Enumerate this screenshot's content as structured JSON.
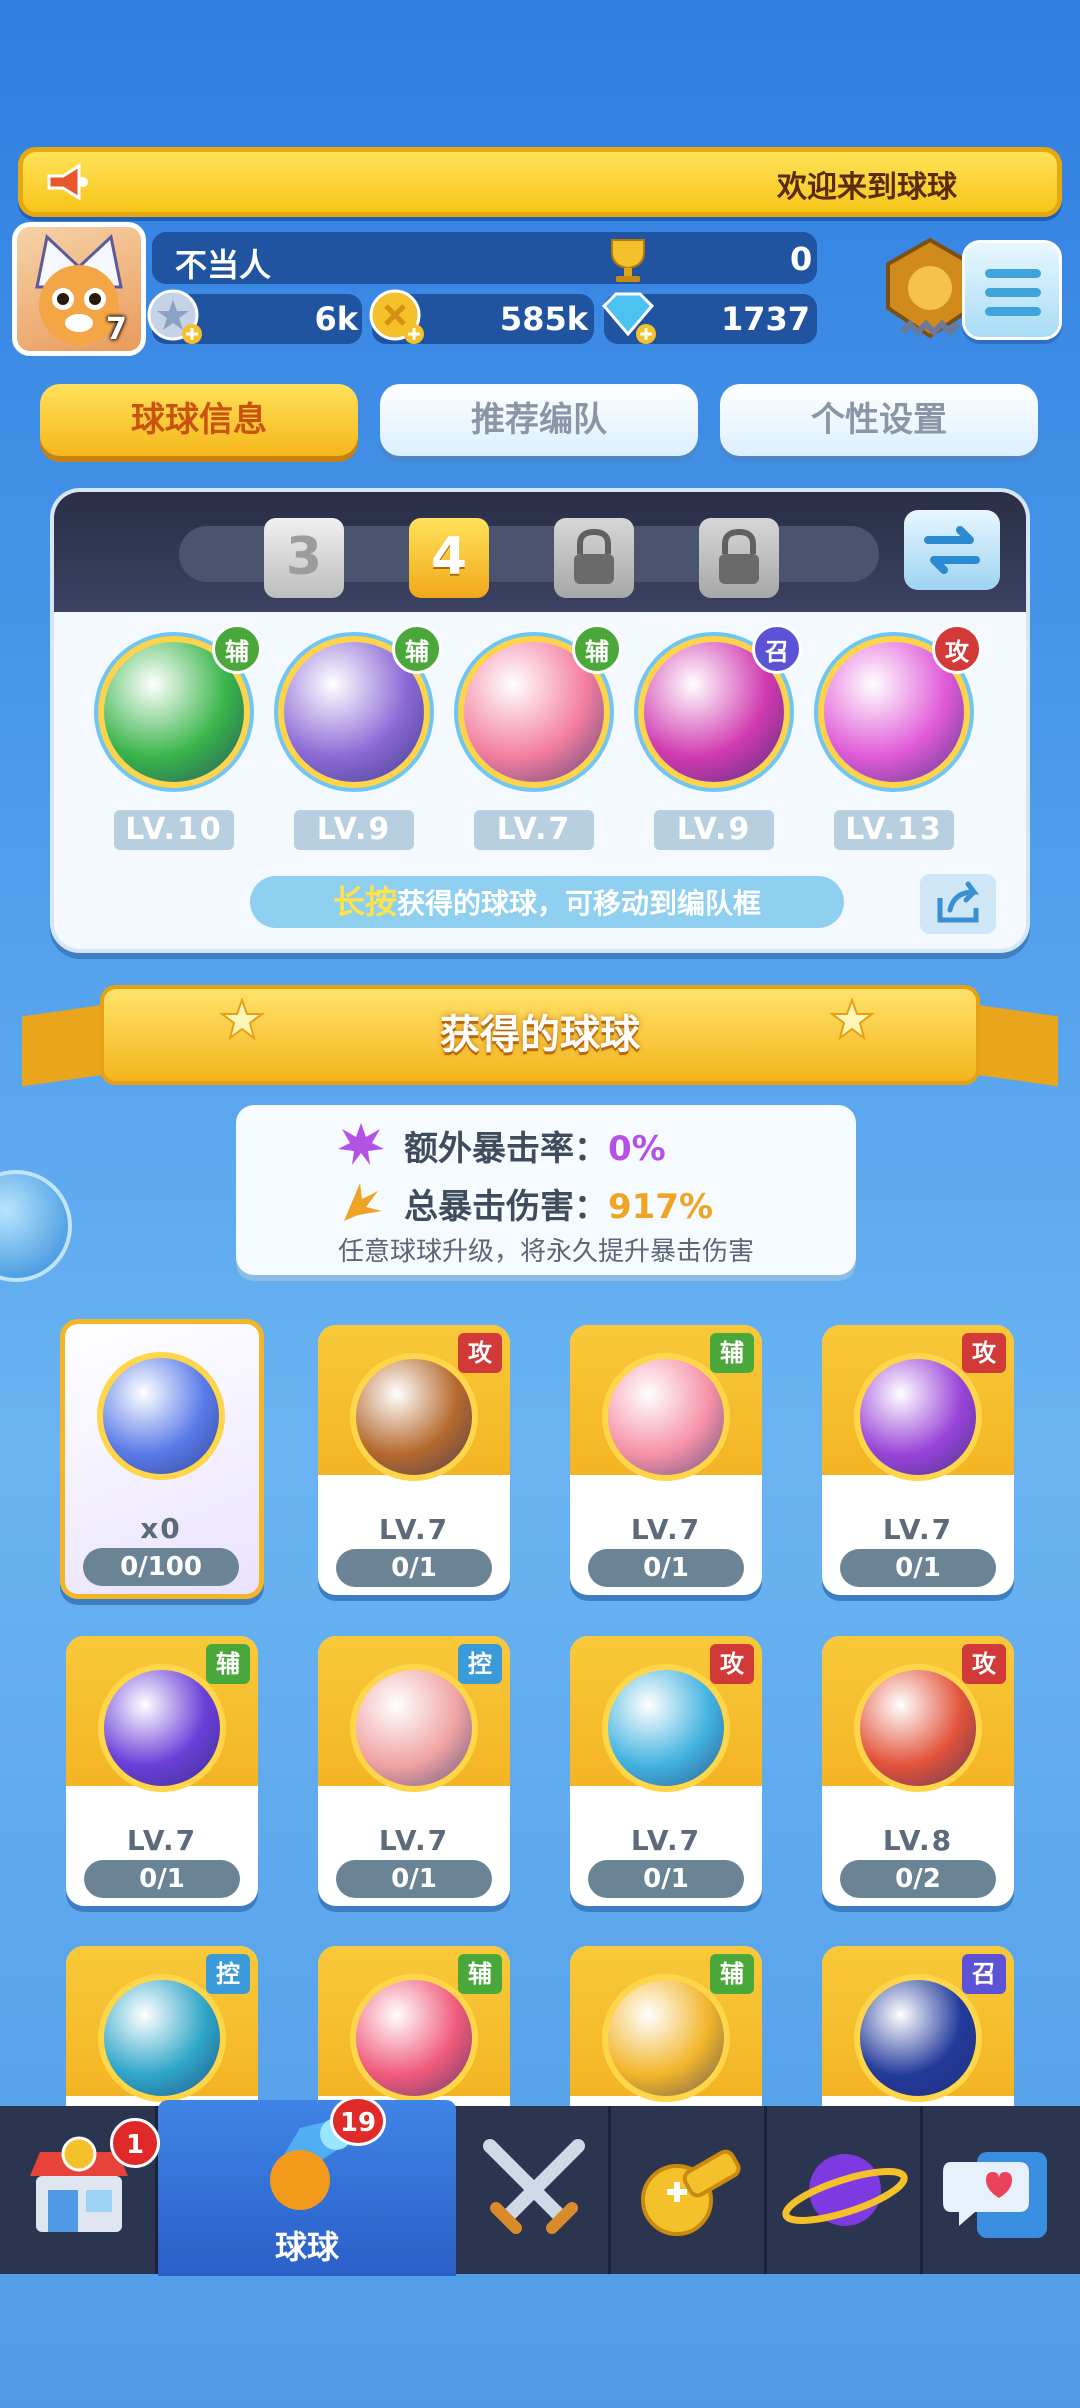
{
  "marquee": {
    "text": "欢迎来到球球"
  },
  "profile": {
    "avatar_level": "7",
    "name": "不当人",
    "trophies": "0",
    "resources": {
      "stars": "6k",
      "coins": "585k",
      "gems": "1737"
    }
  },
  "tabs": [
    "球球信息",
    "推荐编队",
    "个性设置"
  ],
  "lineup": {
    "slots": [
      "3",
      "4"
    ],
    "balls": [
      {
        "tag": "辅",
        "level": "LV.10",
        "color": "#39b54a"
      },
      {
        "tag": "辅",
        "level": "LV.9",
        "color": "#8b6ad6"
      },
      {
        "tag": "辅",
        "level": "LV.7",
        "color": "#f37ea0"
      },
      {
        "tag": "召",
        "level": "LV.9",
        "color": "#d03ab0"
      },
      {
        "tag": "攻",
        "level": "LV.13",
        "color": "#e05ad8"
      }
    ],
    "hint_highlight": "长按",
    "hint_text": "获得的球球，可移动到编队框"
  },
  "section_title": "获得的球球",
  "crit": {
    "extra_label": "额外暴击率：",
    "extra_value": "0%",
    "total_label": "总暴击伤害：",
    "total_value": "917%",
    "note": "任意球球升级，将永久提升暴击伤害"
  },
  "cards": [
    {
      "tag": "",
      "level": "x0",
      "progress": "0/100",
      "color": "#5a7be8",
      "special": true
    },
    {
      "tag": "攻",
      "level": "LV.7",
      "progress": "0/1",
      "color": "#b5692d"
    },
    {
      "tag": "辅",
      "level": "LV.7",
      "progress": "0/1",
      "color": "#f592a8"
    },
    {
      "tag": "攻",
      "level": "LV.7",
      "progress": "0/1",
      "color": "#9a44d8"
    },
    {
      "tag": "辅",
      "level": "LV.7",
      "progress": "0/1",
      "color": "#6a3fd8"
    },
    {
      "tag": "控",
      "level": "LV.7",
      "progress": "0/1",
      "color": "#f0a3a3"
    },
    {
      "tag": "攻",
      "level": "LV.7",
      "progress": "0/1",
      "color": "#43b3e0"
    },
    {
      "tag": "攻",
      "level": "LV.8",
      "progress": "0/2",
      "color": "#e2533a"
    },
    {
      "tag": "控",
      "level": "",
      "progress": "",
      "color": "#2fa6c8"
    },
    {
      "tag": "辅",
      "level": "",
      "progress": "",
      "color": "#f05a7a"
    },
    {
      "tag": "辅",
      "level": "",
      "progress": "",
      "color": "#f2b52a"
    },
    {
      "tag": "召",
      "level": "",
      "progress": "",
      "color": "#233a9a"
    }
  ],
  "nav": {
    "shop_badge": "1",
    "balls_badge": "19",
    "balls_label": "球球"
  }
}
